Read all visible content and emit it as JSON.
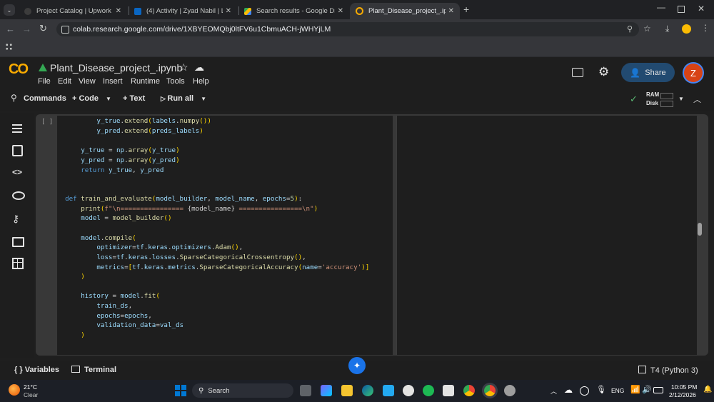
{
  "browser": {
    "tabs": [
      {
        "title": "Project Catalog | Upwork",
        "active": false
      },
      {
        "title": "(4) Activity | Zyad Nabil | LinkedIn",
        "active": false
      },
      {
        "title": "Search results - Google Drive",
        "active": false
      },
      {
        "title": "Plant_Disease_project_.ipynb - Colab",
        "active": true
      }
    ],
    "url": "colab.research.google.com/drive/1XBYEOMQbj0ltFV6u1CbmuACH-jWHYjLM"
  },
  "colab": {
    "logo": "CO",
    "notebook_title": "Plant_Disease_project_.ipynb",
    "menu": [
      "File",
      "Edit",
      "View",
      "Insert",
      "Runtime",
      "Tools",
      "Help"
    ],
    "share_label": "Share",
    "avatar_letter": "Z",
    "toolbar": {
      "commands": "Commands",
      "code": "Code",
      "text": "Text",
      "run_all": "Run all",
      "ram": "RAM",
      "disk": "Disk"
    },
    "cell_run_label": "[ ]",
    "bottom": {
      "variables": "Variables",
      "terminal": "Terminal",
      "runtime": "T4 (Python 3)"
    }
  },
  "taskbar": {
    "weather_temp": "21°C",
    "weather_desc": "Clear",
    "search": "Search",
    "lang": "ENG",
    "time": "10:05 PM",
    "date": "2/12/2026"
  },
  "colors": {
    "share_bg": "#224a70",
    "avatar": "#d84315",
    "colab_orange": "#f9ab00",
    "keyword": "#569cd6",
    "function": "#dcdcaa",
    "string": "#ce9178"
  }
}
